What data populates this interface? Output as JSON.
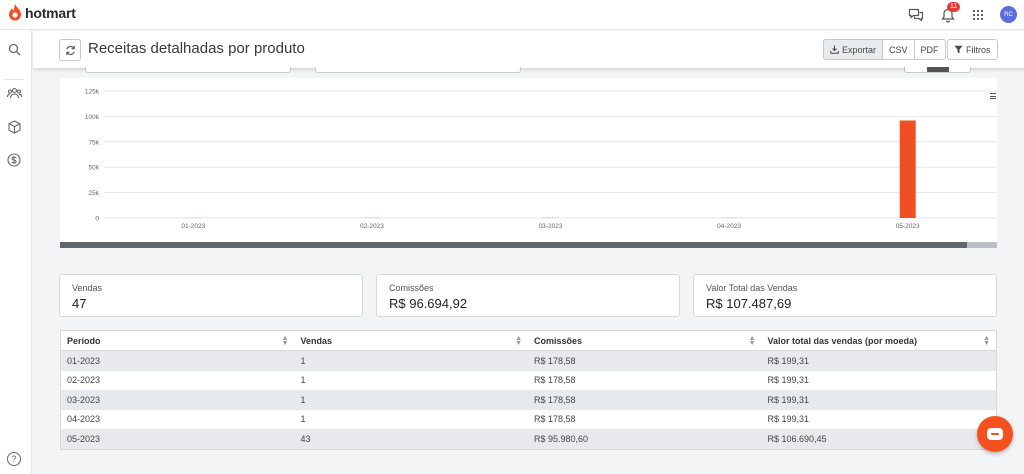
{
  "brand": {
    "name": "hotmart",
    "color": "#f04e23"
  },
  "topbar": {
    "notifications_count": "11",
    "avatar_initials": "RC"
  },
  "header": {
    "title": "Receitas detalhadas por produto",
    "export_label": "Exportar",
    "csv_label": "CSV",
    "pdf_label": "PDF",
    "filter_label": "Filtros"
  },
  "chart_data": {
    "type": "bar",
    "categories": [
      "01-2023",
      "02-2023",
      "03-2023",
      "04-2023",
      "05-2023"
    ],
    "values": [
      178.58,
      178.58,
      178.58,
      178.58,
      95980.6
    ],
    "ylim": [
      0,
      125000
    ],
    "yticks": [
      "0",
      "25k",
      "50k",
      "75k",
      "100k",
      "125k"
    ],
    "bar_color": "#f04e23",
    "grid": true
  },
  "cards": [
    {
      "label": "Vendas",
      "value": "47"
    },
    {
      "label": "Comissões",
      "value": "R$ 96.694,92"
    },
    {
      "label": "Valor Total das Vendas",
      "value": "R$ 107.487,69"
    }
  ],
  "table": {
    "headers": [
      "Período",
      "Vendas",
      "Comissões",
      "Valor total das vendas (por moeda)"
    ],
    "rows": [
      [
        "01-2023",
        "1",
        "R$ 178,58",
        "R$ 199,31"
      ],
      [
        "02-2023",
        "1",
        "R$ 178,58",
        "R$ 199,31"
      ],
      [
        "03-2023",
        "1",
        "R$ 178,58",
        "R$ 199,31"
      ],
      [
        "04-2023",
        "1",
        "R$ 178,58",
        "R$ 199,31"
      ],
      [
        "05-2023",
        "43",
        "R$ 95.980,60",
        "R$ 106.690,45"
      ]
    ]
  },
  "help_label": "?"
}
